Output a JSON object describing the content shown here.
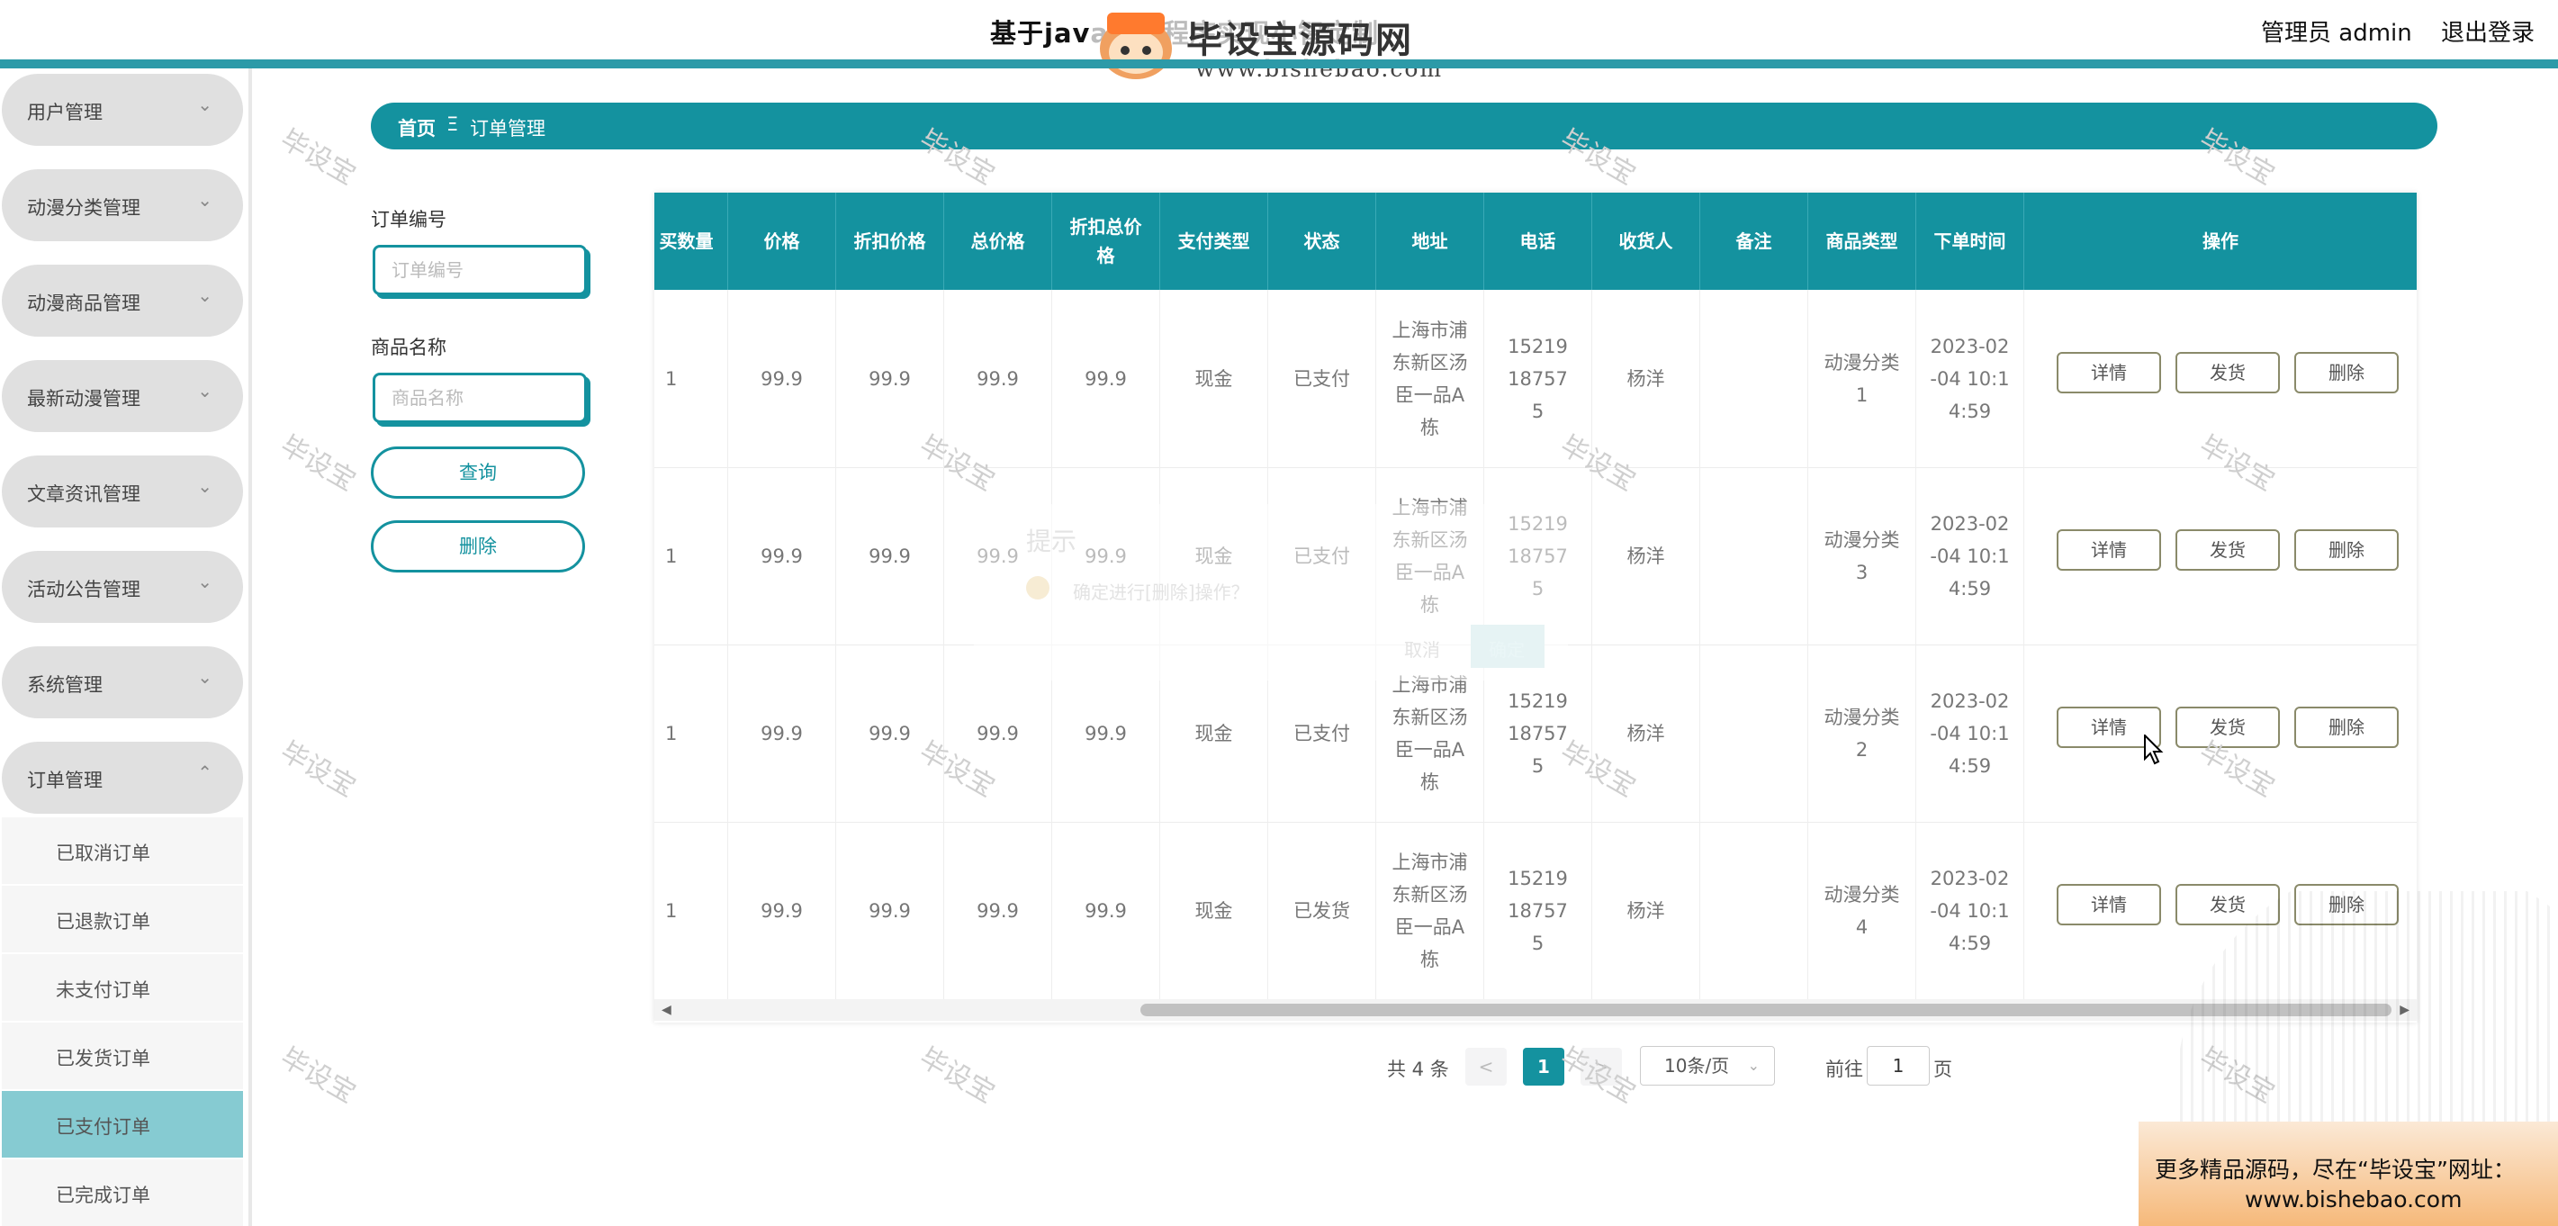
{
  "header": {
    "title": "基于java的小程序实现小智定制",
    "admin_label": "管理员 admin",
    "logout_label": "退出登录"
  },
  "watermark": {
    "brand": "毕设宝源码网",
    "url": "www.bishebao.com",
    "stamp_text": "毕设宝",
    "promo_line1": "更多精品源码，尽在“毕设宝”网址：",
    "promo_line2": "www.bishebao.com"
  },
  "sidebar": {
    "menus": [
      {
        "label": "用户管理",
        "chevron": "⌄"
      },
      {
        "label": "动漫分类管理",
        "chevron": "⌄"
      },
      {
        "label": "动漫商品管理",
        "chevron": "⌄"
      },
      {
        "label": "最新动漫管理",
        "chevron": "⌄"
      },
      {
        "label": "文章资讯管理",
        "chevron": "⌄"
      },
      {
        "label": "活动公告管理",
        "chevron": "⌄"
      },
      {
        "label": "系统管理",
        "chevron": "⌄"
      },
      {
        "label": "订单管理",
        "chevron": "⌃"
      }
    ],
    "sub_items": [
      {
        "label": "已取消订单"
      },
      {
        "label": "已退款订单"
      },
      {
        "label": "未支付订单"
      },
      {
        "label": "已发货订单"
      },
      {
        "label": "已支付订单",
        "active": true
      },
      {
        "label": "已完成订单"
      }
    ]
  },
  "breadcrumb": {
    "home": "首页",
    "separator": "Ξ",
    "current": "订单管理"
  },
  "search": {
    "order_no_label": "订单编号",
    "order_no_placeholder": "订单编号",
    "product_name_label": "商品名称",
    "product_name_placeholder": "商品名称",
    "query_label": "查询",
    "delete_label": "删除"
  },
  "table": {
    "columns": [
      "买数量",
      "价格",
      "折扣价格",
      "总价格",
      "折扣总价格",
      "支付类型",
      "状态",
      "地址",
      "电话",
      "收货人",
      "备注",
      "商品类型",
      "下单时间",
      "操作"
    ],
    "rows": [
      {
        "qty": "1",
        "price": "99.9",
        "discount_price": "99.9",
        "total": "99.9",
        "discount_total": "99.9",
        "pay_type": "现金",
        "status": "已支付",
        "address": "上海市浦东新区汤臣一品A栋",
        "phone": "15219187575",
        "receiver": "杨洋",
        "remark": "",
        "category": "动漫分类1",
        "time": "2023-02-04 10:14:59"
      },
      {
        "qty": "1",
        "price": "99.9",
        "discount_price": "99.9",
        "total": "99.9",
        "discount_total": "99.9",
        "pay_type": "现金",
        "status": "已支付",
        "address": "上海市浦东新区汤臣一品A栋",
        "phone": "15219187575",
        "receiver": "杨洋",
        "remark": "",
        "category": "动漫分类3",
        "time": "2023-02-04 10:14:59"
      },
      {
        "qty": "1",
        "price": "99.9",
        "discount_price": "99.9",
        "total": "99.9",
        "discount_total": "99.9",
        "pay_type": "现金",
        "status": "已支付",
        "address": "上海市浦东新区汤臣一品A栋",
        "phone": "15219187575",
        "receiver": "杨洋",
        "remark": "",
        "category": "动漫分类2",
        "time": "2023-02-04 10:14:59"
      },
      {
        "qty": "1",
        "price": "99.9",
        "discount_price": "99.9",
        "total": "99.9",
        "discount_total": "99.9",
        "pay_type": "现金",
        "status": "已发货",
        "address": "上海市浦东新区汤臣一品A栋",
        "phone": "15219187575",
        "receiver": "杨洋",
        "remark": "",
        "category": "动漫分类4",
        "time": "2023-02-04 10:14:59"
      }
    ],
    "actions": {
      "detail": "详情",
      "ship": "发货",
      "delete": "删除"
    }
  },
  "pagination": {
    "total_text": "共 4 条",
    "prev": "<",
    "current_page": "1",
    "next": ">",
    "page_size": "10条/页",
    "goto_label": "前往",
    "goto_value": "1",
    "page_suffix": "页"
  },
  "ghost_dialog": {
    "title": "提示",
    "message": "确定进行[删除]操作？",
    "cancel": "取消",
    "confirm": "确定"
  },
  "colors": {
    "accent": "#14929f",
    "menu_bg": "#e0e0e0",
    "active_sub": "#86cbd2",
    "page_active": "#14929f"
  }
}
